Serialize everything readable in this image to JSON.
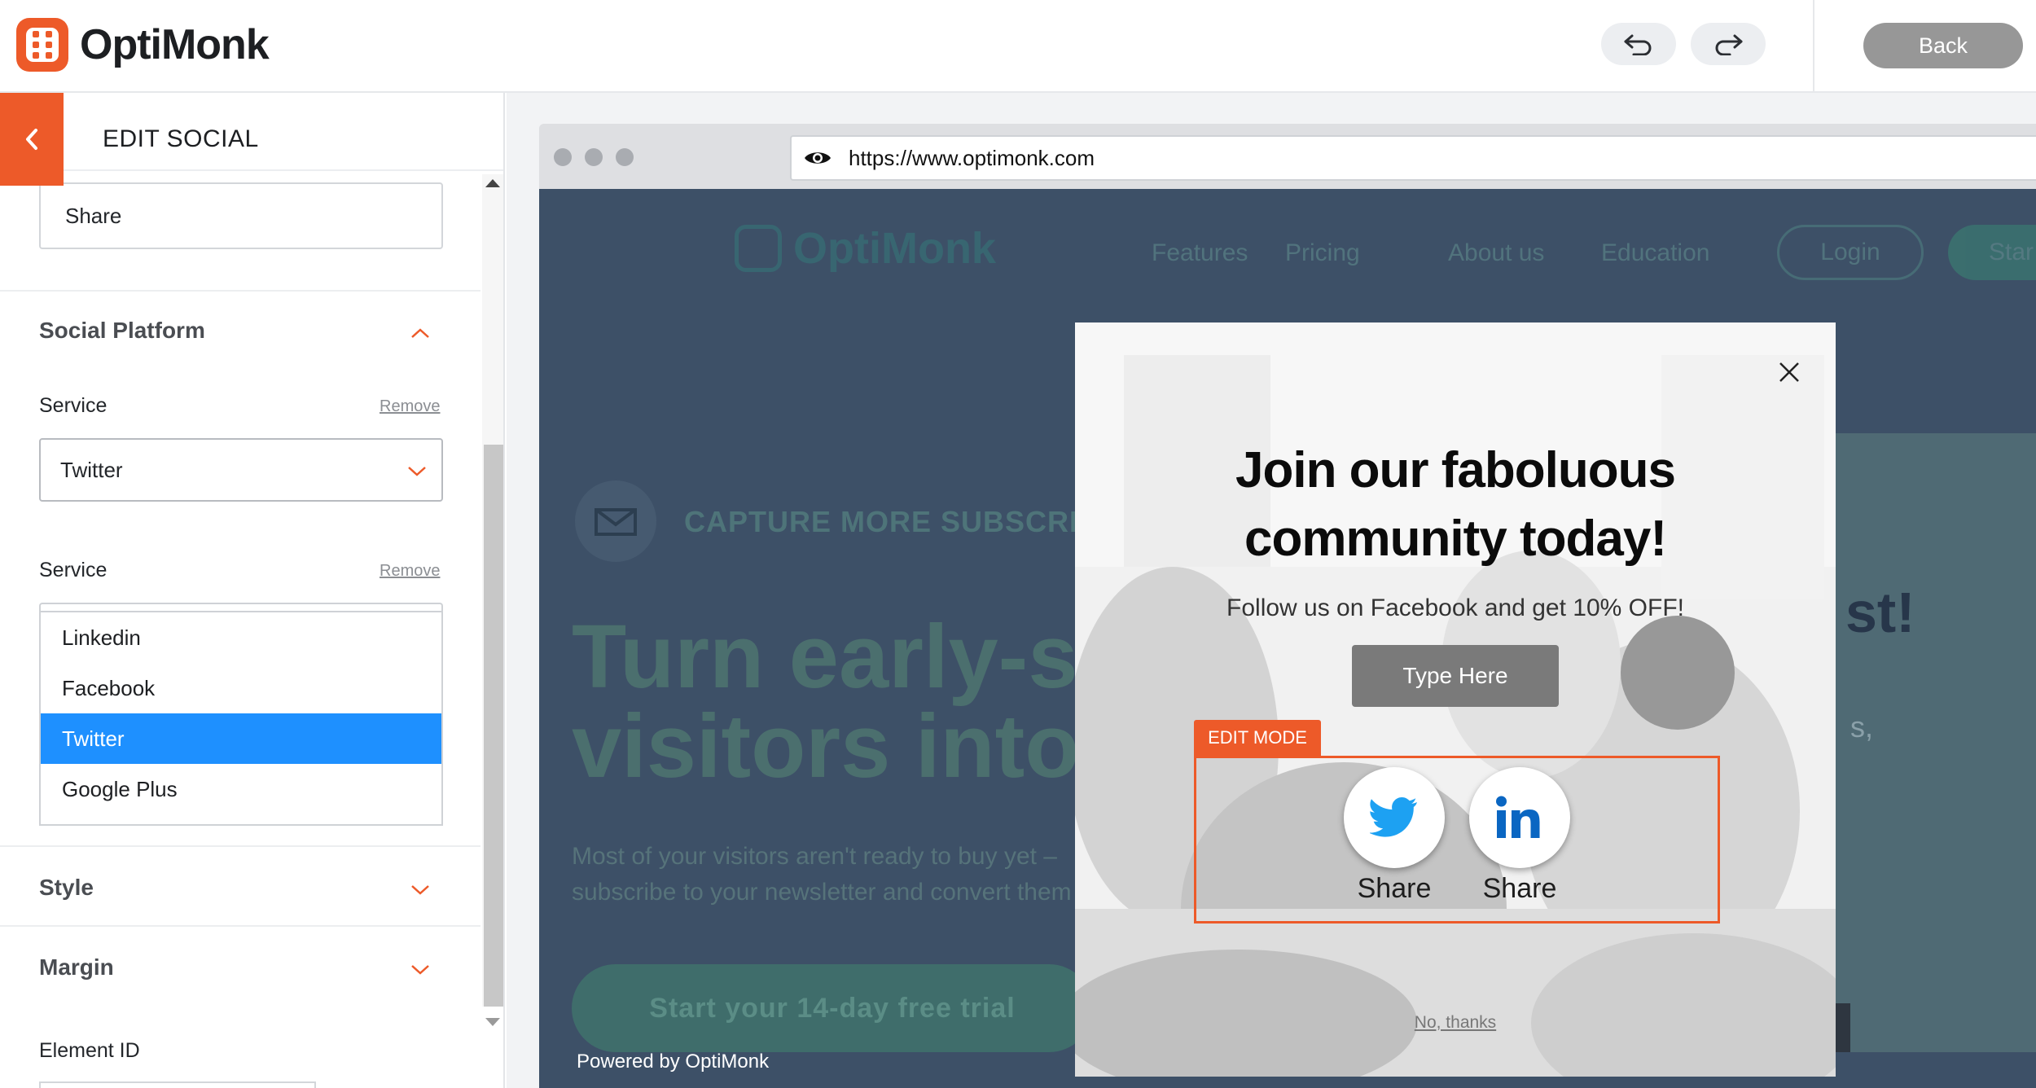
{
  "app": {
    "brand": "OptiMonk",
    "back_label": "Back",
    "accent_color": "#ed5a29"
  },
  "panel": {
    "title": "EDIT SOCIAL",
    "share_input_value": "Share",
    "sections": {
      "social_platform": "Social Platform",
      "style": "Style",
      "margin": "Margin"
    },
    "service_label": "Service",
    "remove_label": "Remove",
    "service_1_value": "Twitter",
    "service_2_options": [
      "Linkedin",
      "Facebook",
      "Twitter",
      "Google Plus"
    ],
    "service_2_selected": "Twitter",
    "element_id_label": "Element ID"
  },
  "browser": {
    "url": "https://www.optimonk.com"
  },
  "site": {
    "logo": "OptiMonk",
    "nav": [
      "Features",
      "Pricing",
      "About us",
      "Education"
    ],
    "login": "Login",
    "start": "Star",
    "tagline": "CAPTURE MORE SUBSCRIBER",
    "title_line1": "Turn early-s",
    "title_line2": "visitors into",
    "subtitle_line1": "Most of your visitors aren't ready to buy yet –",
    "subtitle_line2": "subscribe to your newsletter and convert them",
    "cta": "Start your 14-day free trial",
    "right_fragment_1": "st!",
    "right_fragment_2": "s,",
    "powered_by": "Powered by OptiMonk"
  },
  "popup": {
    "title_line1": "Join our faboluous",
    "title_line2": "community today!",
    "subtitle": "Follow us on Facebook and get 10% OFF!",
    "button": "Type Here",
    "edit_mode": "EDIT MODE",
    "social": [
      {
        "icon": "twitter-icon",
        "label": "Share",
        "color": "#1da1f2"
      },
      {
        "icon": "linkedin-icon",
        "label": "Share",
        "color": "#0a66c2"
      }
    ],
    "no_thanks": "No, thanks"
  }
}
